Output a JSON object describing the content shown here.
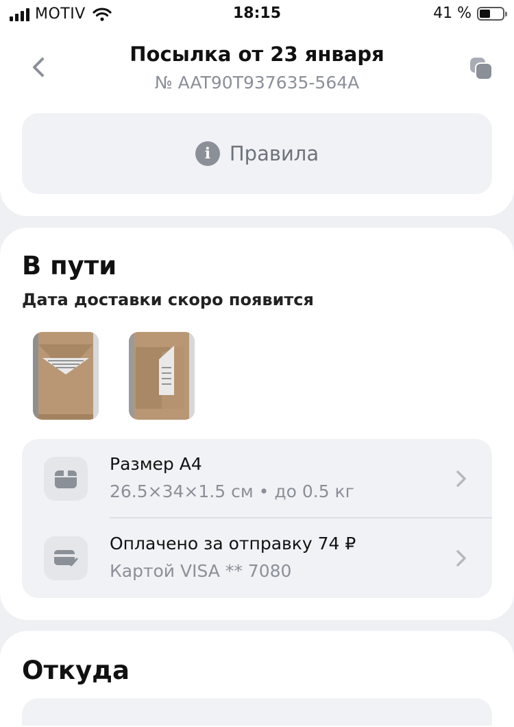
{
  "status_bar": {
    "carrier": "MOTIV",
    "time": "18:15",
    "battery": "41 %",
    "battery_level_percent": 41
  },
  "header": {
    "title": "Посылка от 23 января",
    "tracking_number": "№ AAT90T937635-564A",
    "back_icon": "chevron-left-icon",
    "copy_icon": "copy-icon"
  },
  "rules": {
    "label": "Правила",
    "icon": "info-icon"
  },
  "shipment_status": {
    "title": "В пути",
    "subtitle": "Дата доставки скоро появится",
    "photos": [
      "envelope-photo-front",
      "envelope-photo-side"
    ]
  },
  "details": {
    "size": {
      "title": "Размер A4",
      "subtitle": "26.5×34×1.5 см • до 0.5 кг",
      "icon": "box-icon"
    },
    "payment": {
      "title": "Оплачено за отправку 74 ₽",
      "subtitle": "Картой VISA ** 7080",
      "icon": "card-check-icon"
    }
  },
  "origin": {
    "title": "Откуда"
  },
  "colors": {
    "background": "#eef0f3",
    "card": "#ffffff",
    "muted_fill": "#f1f2f5",
    "muted_text": "#8a8f98"
  }
}
